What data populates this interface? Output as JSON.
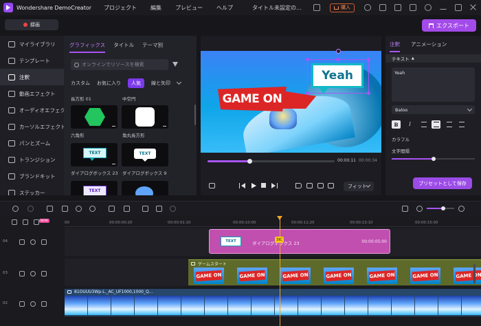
{
  "titlebar": {
    "app_name": "Wondershare DemoCreator",
    "menu": [
      "プロジェクト",
      "編集",
      "プレビュー",
      "ヘルプ"
    ],
    "document_title": "タイトル未設定の...",
    "buy_label": "購入"
  },
  "toolbar": {
    "record_label": "録画",
    "export_label": "エクスポート"
  },
  "leftnav": {
    "items": [
      {
        "label": "マイライブラリ",
        "icon": "library-icon"
      },
      {
        "label": "テンプレート",
        "icon": "template-icon"
      },
      {
        "label": "注釈",
        "icon": "annotation-icon",
        "active": true
      },
      {
        "label": "動画エフェクト",
        "icon": "video-effect-icon"
      },
      {
        "label": "オーディオエフェクト",
        "icon": "audio-effect-icon"
      },
      {
        "label": "カーソルエフェクト",
        "icon": "cursor-effect-icon"
      },
      {
        "label": "パンとズーム",
        "icon": "pan-zoom-icon"
      },
      {
        "label": "トランジション",
        "icon": "transition-icon"
      },
      {
        "label": "ブランドキット",
        "icon": "brand-kit-icon"
      },
      {
        "label": "ステッカー",
        "icon": "sticker-icon"
      }
    ]
  },
  "library": {
    "tabs": [
      "グラフィックス",
      "タイトル",
      "テーマ別"
    ],
    "active_tab": "グラフィックス",
    "search_placeholder": "オンラインでリソースを検索",
    "categories": [
      "カスタム",
      "お気に入り",
      "人気",
      "線と矢印"
    ],
    "active_category": "人気",
    "section_labels": [
      "長方形 01",
      "中空円"
    ],
    "items": [
      {
        "label": "六角形",
        "thumb": "hexagon"
      },
      {
        "label": "角丸長方形",
        "thumb": "rounded-rect"
      },
      {
        "label": "ダイアログボックス 23",
        "thumb_text": "TEXT"
      },
      {
        "label": "ダイアログボックス 9",
        "thumb_text": "TEXT"
      },
      {
        "label": "",
        "thumb_text": "TEXT"
      }
    ]
  },
  "preview": {
    "gameon_text": "GAME ON",
    "callout_text": "Yeah",
    "time_current": "00:00:11",
    "time_total": "00:00:34",
    "progress": 0.33,
    "fit_label": "フィット"
  },
  "props": {
    "tabs": [
      "注釈",
      "アニメーション"
    ],
    "active_tab": "注釈",
    "section_title": "テキスト",
    "text_value": "Yeah",
    "font_value": "Baloo",
    "color_label": "カラフル",
    "spacing_label": "文字間隔",
    "spacing_value": 0.5,
    "preset_button": "プリセットとして保存"
  },
  "timeline": {
    "ruler_ticks": [
      "00",
      "00:00:00:20",
      "00:00:01:10",
      "00:00:10:00",
      "00:00:11:20",
      "00:00:13:10",
      "00:00:15:00"
    ],
    "zoom": 0.6,
    "new_badge": "NEW",
    "tracks": [
      "04",
      "03",
      "02"
    ],
    "callout_clip": {
      "name": "ダイアログボックス 23",
      "duration": "00:00:05:00",
      "thumb_text": "TEXT"
    },
    "game_clip": {
      "name": "ゲームスタート",
      "thumb_text": "GAME ON",
      "count": 7
    },
    "video_clip": {
      "name": "81OUUU3Wp-L._AC_UF1000,1000_Q...",
      "count": 18
    },
    "playhead_badge": "3IC"
  },
  "colors": {
    "accent": "#a855f7",
    "record": "#ef4444",
    "callout_clip": "#c04fb0",
    "game_clip": "#5e6a2a",
    "playhead": "#f5a623"
  }
}
